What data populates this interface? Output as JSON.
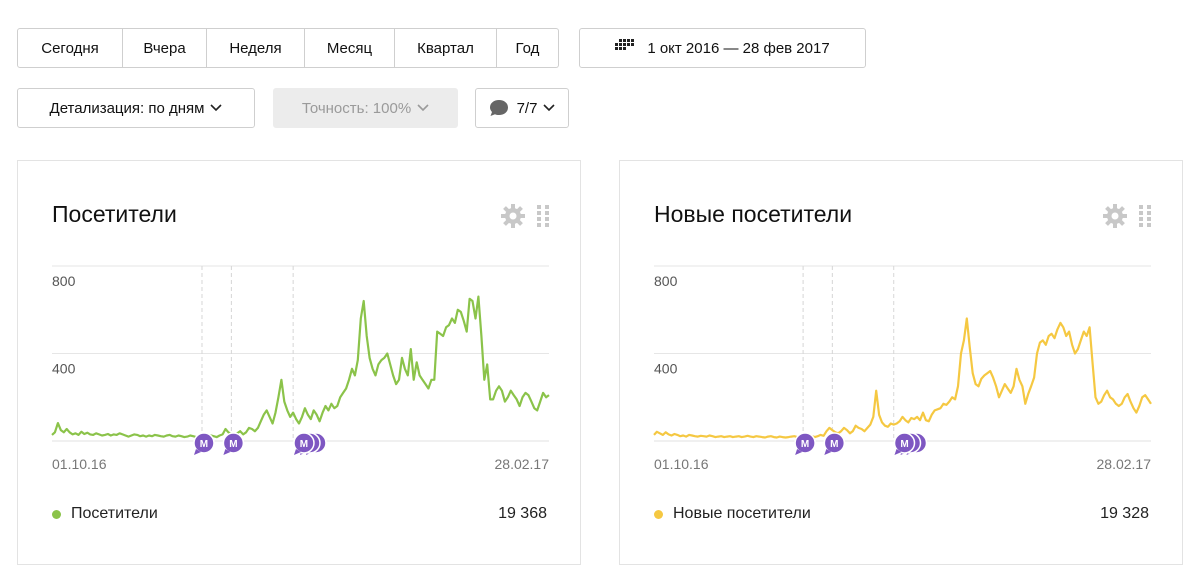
{
  "period_tabs": [
    "Сегодня",
    "Вчера",
    "Неделя",
    "Месяц",
    "Квартал",
    "Год"
  ],
  "date_range": "1 окт 2016 — 28 фев 2017",
  "detail_label": "Детализация: по дням",
  "accuracy_label": "Точность: 100%",
  "notes_count": "7/7",
  "widgets": [
    {
      "title": "Посетители",
      "legend": "Посетители",
      "total": "19 368",
      "color": "#8bc34a"
    },
    {
      "title": "Новые посетители",
      "legend": "Новые посетители",
      "total": "19 328",
      "color": "#f5c842"
    }
  ],
  "chart_data": [
    {
      "type": "line",
      "title": "Посетители",
      "x_start": "01.10.16",
      "x_end": "28.02.17",
      "ylim": [
        0,
        800
      ],
      "yticks": [
        "800",
        "400"
      ],
      "grid": true,
      "series": [
        {
          "name": "Посетители",
          "values": [
            28,
            40,
            82,
            50,
            40,
            55,
            40,
            30,
            35,
            28,
            42,
            32,
            38,
            30,
            28,
            35,
            30,
            25,
            28,
            32,
            25,
            30,
            28,
            35,
            30,
            25,
            20,
            25,
            30,
            28,
            22,
            25,
            20,
            25,
            22,
            28,
            25,
            22,
            20,
            25,
            28,
            22,
            20,
            25,
            22,
            18,
            20,
            25,
            22,
            18,
            20,
            25,
            22,
            28,
            25,
            22,
            18,
            25,
            30,
            55,
            40,
            30,
            25,
            35,
            45,
            30,
            40,
            60,
            55,
            45,
            60,
            90,
            120,
            140,
            110,
            80,
            130,
            200,
            280,
            180,
            140,
            110,
            130,
            100,
            80,
            110,
            150,
            120,
            100,
            140,
            120,
            90,
            130,
            160,
            140,
            170,
            150,
            160,
            200,
            220,
            240,
            280,
            330,
            300,
            370,
            560,
            640,
            480,
            380,
            330,
            300,
            350,
            370,
            380,
            400,
            350,
            300,
            260,
            280,
            380,
            330,
            300,
            420,
            280,
            360,
            300,
            280,
            260,
            240,
            280,
            280,
            500,
            490,
            480,
            520,
            530,
            560,
            540,
            600,
            590,
            550,
            500,
            650,
            640,
            560,
            660,
            480,
            280,
            350,
            190,
            190,
            230,
            250,
            230,
            180,
            200,
            230,
            210,
            190,
            160,
            200,
            220,
            210,
            180,
            150,
            140,
            180,
            220,
            200,
            210
          ]
        }
      ],
      "notes": [
        "М",
        "М",
        "М"
      ]
    },
    {
      "type": "line",
      "title": "Новые посетители",
      "x_start": "01.10.16",
      "x_end": "28.02.17",
      "ylim": [
        0,
        800
      ],
      "yticks": [
        "800",
        "400"
      ],
      "grid": true,
      "series": [
        {
          "name": "Новые посетители",
          "values": [
            28,
            42,
            35,
            28,
            40,
            30,
            25,
            32,
            28,
            22,
            25,
            20,
            28,
            25,
            22,
            20,
            24,
            22,
            20,
            25,
            22,
            18,
            20,
            22,
            18,
            20,
            22,
            18,
            20,
            22,
            18,
            20,
            24,
            20,
            18,
            22,
            20,
            18,
            16,
            20,
            22,
            18,
            16,
            20,
            18,
            16,
            18,
            20,
            22,
            18,
            16,
            20,
            24,
            28,
            22,
            18,
            22,
            28,
            24,
            45,
            60,
            50,
            40,
            35,
            45,
            60,
            50,
            35,
            45,
            70,
            60,
            55,
            45,
            60,
            75,
            110,
            230,
            120,
            85,
            70,
            65,
            80,
            75,
            80,
            90,
            110,
            95,
            85,
            105,
            100,
            110,
            95,
            130,
            95,
            90,
            120,
            140,
            145,
            150,
            170,
            165,
            180,
            200,
            190,
            250,
            400,
            460,
            560,
            430,
            310,
            260,
            250,
            285,
            300,
            310,
            320,
            290,
            250,
            200,
            230,
            260,
            240,
            220,
            250,
            330,
            280,
            250,
            170,
            215,
            250,
            290,
            400,
            450,
            460,
            440,
            480,
            490,
            470,
            510,
            540,
            520,
            480,
            500,
            440,
            400,
            420,
            460,
            500,
            480,
            520,
            360,
            200,
            170,
            180,
            210,
            230,
            200,
            190,
            170,
            160,
            170,
            200,
            215,
            180,
            150,
            130,
            160,
            200,
            210,
            190,
            170
          ]
        }
      ],
      "notes": [
        "М",
        "М",
        "М"
      ]
    }
  ]
}
